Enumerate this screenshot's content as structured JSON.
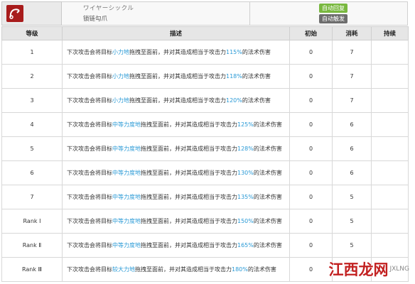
{
  "skill": {
    "name_jp": "ワイヤーシックル",
    "name_cn": "锁链勾爪",
    "badges": [
      "自动回复",
      "自动触发"
    ],
    "icon": "chain-hook-icon"
  },
  "columns": [
    "等级",
    "描述",
    "初始",
    "消耗",
    "持续"
  ],
  "rows": [
    {
      "level": "1",
      "pre": "下次攻击会将目标",
      "force": "小力地",
      "mid": "拖拽至面前，并对其造成相当于攻击力",
      "pct": "115%",
      "post": "的法术伤害",
      "initial": "0",
      "cost": "7",
      "duration": ""
    },
    {
      "level": "2",
      "pre": "下次攻击会将目标",
      "force": "小力地",
      "mid": "拖拽至面前，并对其造成相当于攻击力",
      "pct": "118%",
      "post": "的法术伤害",
      "initial": "0",
      "cost": "7",
      "duration": ""
    },
    {
      "level": "3",
      "pre": "下次攻击会将目标",
      "force": "小力地",
      "mid": "拖拽至面前，并对其造成相当于攻击力",
      "pct": "120%",
      "post": "的法术伤害",
      "initial": "0",
      "cost": "7",
      "duration": ""
    },
    {
      "level": "4",
      "pre": "下次攻击会将目标",
      "force": "中等力度地",
      "mid": "拖拽至面前，并对其造成相当于攻击力",
      "pct": "125%",
      "post": "的法术伤害",
      "initial": "0",
      "cost": "6",
      "duration": ""
    },
    {
      "level": "5",
      "pre": "下次攻击会将目标",
      "force": "中等力度地",
      "mid": "拖拽至面前，并对其造成相当于攻击力",
      "pct": "128%",
      "post": "的法术伤害",
      "initial": "0",
      "cost": "6",
      "duration": ""
    },
    {
      "level": "6",
      "pre": "下次攻击会将目标",
      "force": "中等力度地",
      "mid": "拖拽至面前，并对其造成相当于攻击力",
      "pct": "130%",
      "post": "的法术伤害",
      "initial": "0",
      "cost": "6",
      "duration": ""
    },
    {
      "level": "7",
      "pre": "下次攻击会将目标",
      "force": "中等力度地",
      "mid": "拖拽至面前，并对其造成相当于攻击力",
      "pct": "135%",
      "post": "的法术伤害",
      "initial": "0",
      "cost": "5",
      "duration": ""
    },
    {
      "level": "Rank Ⅰ",
      "pre": "下次攻击会将目标",
      "force": "中等力度地",
      "mid": "拖拽至面前，并对其造成相当于攻击力",
      "pct": "150%",
      "post": "的法术伤害",
      "initial": "0",
      "cost": "5",
      "duration": ""
    },
    {
      "level": "Rank Ⅱ",
      "pre": "下次攻击会将目标",
      "force": "中等力度地",
      "mid": "拖拽至面前，并对其造成相当于攻击力",
      "pct": "165%",
      "post": "的法术伤害",
      "initial": "0",
      "cost": "5",
      "duration": ""
    },
    {
      "level": "Rank Ⅲ",
      "pre": "下次攻击会将目标",
      "force": "较大力地",
      "mid": "拖拽至面前，并对其造成相当于攻击力",
      "pct": "180%",
      "post": "的法术伤害",
      "initial": "0",
      "cost": "5",
      "duration": ""
    }
  ],
  "watermark": {
    "main": "江西龙网",
    "sub": "JXLNG"
  },
  "colors": {
    "highlight": "#2a9ad6",
    "badge_auto_recover": "#79b83f",
    "badge_auto_trigger": "#6d6d6d",
    "icon_bg": "#a81c1c"
  }
}
